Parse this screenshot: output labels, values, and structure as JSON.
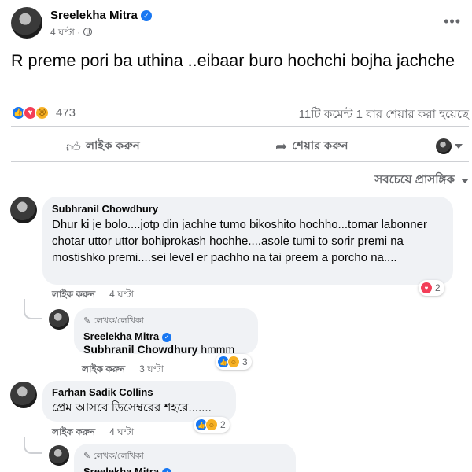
{
  "post": {
    "author": "Sreelekha Mitra",
    "time": "4 ঘণ্টা",
    "text": "R preme pori ba uthina ..eibaar buro hochchi bojha jachche",
    "reaction_count": "473",
    "comments_shares": "11টি কমেন্ট  1 বার শেয়ার করা হয়েছে"
  },
  "actions": {
    "like": "লাইক করুন",
    "share": "শেয়ার করুন"
  },
  "sort_label": "সবচেয়ে প্রাসঙ্গিক",
  "comments": [
    {
      "name": "Subhranil Chowdhury",
      "text": "Dhur ki je bolo....jotp din jachhe tumo bikoshito hochho...tomar labonner chotar uttor uttor bohiprokash hochhe....asole tumi to sorir premi na mostishko premi....sei level er pachho na tai preem a porcho na....",
      "like_label": "লাইক করুন",
      "time": "4 ঘণ্টা",
      "reaction_count": "2"
    },
    {
      "badge": "লেখক/লেখিকা",
      "name": "Sreelekha Mitra",
      "mention": "Subhranil Chowdhury",
      "text": "hmmm",
      "like_label": "লাইক করুন",
      "time": "3 ঘণ্টা",
      "reaction_count": "3"
    },
    {
      "name": "Farhan Sadik Collins",
      "text": "প্রেম আসবে ডিসেম্বরের শহরে.......",
      "like_label": "লাইক করুন",
      "time": "4 ঘণ্টা",
      "reaction_count": "2"
    },
    {
      "badge": "লেখক/লেখিকা",
      "name": "Sreelekha Mitra"
    }
  ],
  "colors": {
    "like_blue": "#1877f2",
    "love_red": "#f33e58",
    "reaction_yellow": "#f7b125",
    "secondary_text": "#65676b",
    "bubble_bg": "#f0f2f5"
  }
}
